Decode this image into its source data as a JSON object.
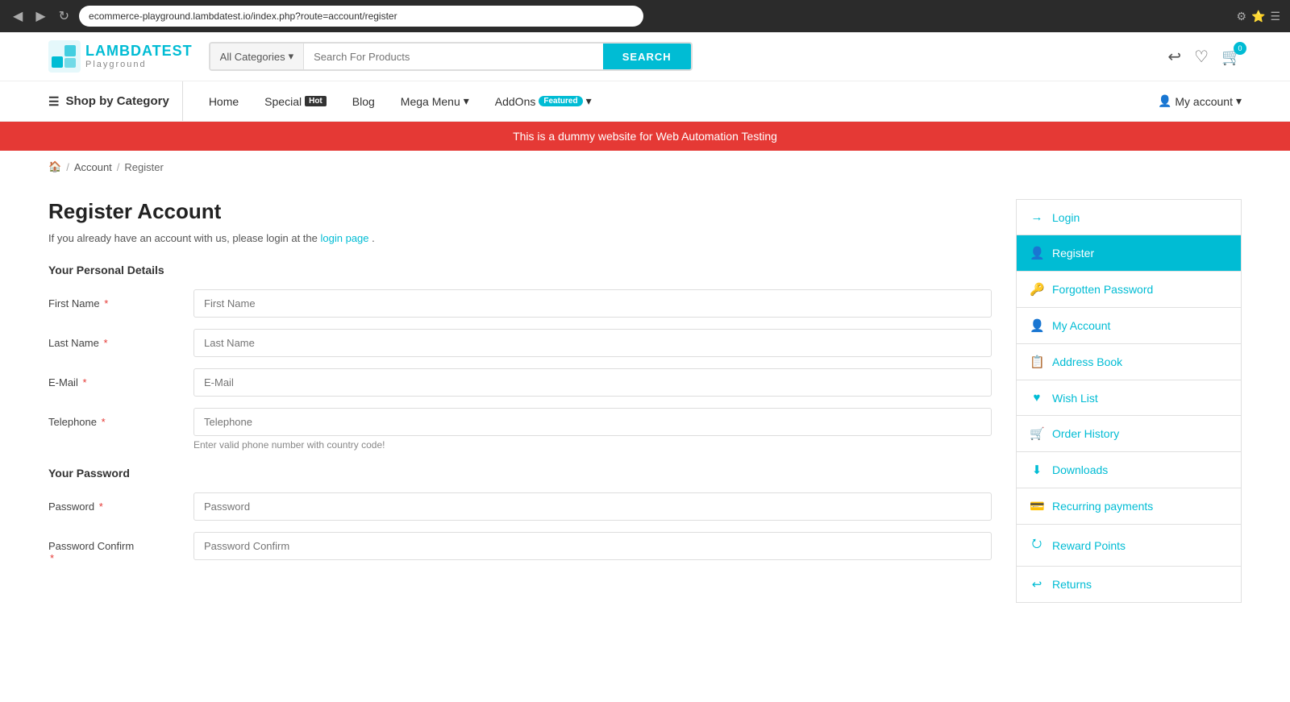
{
  "browser": {
    "url": "ecommerce-playground.lambdatest.io/index.php?route=account/register",
    "nav_back": "◀",
    "nav_forward": "▶",
    "reload": "↻"
  },
  "header": {
    "logo_main": "LAMBDATEST",
    "logo_sub": "Playground",
    "search_category": "All Categories",
    "search_placeholder": "Search For Products",
    "search_button": "SEARCH",
    "cart_count": "0"
  },
  "nav": {
    "shop_by_category": "Shop by Category",
    "home": "Home",
    "special": "Special",
    "special_badge": "Hot",
    "blog": "Blog",
    "mega_menu": "Mega Menu",
    "addons": "AddOns",
    "addons_badge": "Featured",
    "my_account": "My account"
  },
  "banner": {
    "text": "This is a dummy website for Web Automation Testing"
  },
  "breadcrumb": {
    "home_icon": "🏠",
    "account": "Account",
    "register": "Register"
  },
  "form": {
    "title": "Register Account",
    "intro": "If you already have an account with us, please login at the",
    "login_link_text": "login page",
    "intro_end": ".",
    "personal_details_title": "Your Personal Details",
    "first_name_label": "First Name",
    "first_name_placeholder": "First Name",
    "last_name_label": "Last Name",
    "last_name_placeholder": "Last Name",
    "email_label": "E-Mail",
    "email_placeholder": "E-Mail",
    "telephone_label": "Telephone",
    "telephone_placeholder": "Telephone",
    "telephone_hint": "Enter valid phone number with country code!",
    "password_title": "Your Password",
    "password_label": "Password",
    "password_placeholder": "Password",
    "password_confirm_label": "Password Confirm",
    "password_confirm_placeholder": "Password Confirm"
  },
  "sidebar": {
    "items": [
      {
        "id": "login",
        "label": "Login",
        "icon": "→",
        "active": false
      },
      {
        "id": "register",
        "label": "Register",
        "icon": "👤+",
        "active": true
      },
      {
        "id": "forgotten-password",
        "label": "Forgotten Password",
        "icon": "🔑",
        "active": false
      },
      {
        "id": "my-account",
        "label": "My Account",
        "icon": "👤",
        "active": false
      },
      {
        "id": "address-book",
        "label": "Address Book",
        "icon": "📋",
        "active": false
      },
      {
        "id": "wish-list",
        "label": "Wish List",
        "icon": "♥",
        "active": false
      },
      {
        "id": "order-history",
        "label": "Order History",
        "icon": "🛒",
        "active": false
      },
      {
        "id": "downloads",
        "label": "Downloads",
        "icon": "⬇",
        "active": false
      },
      {
        "id": "recurring-payments",
        "label": "Recurring payments",
        "icon": "💳",
        "active": false
      },
      {
        "id": "reward-points",
        "label": "Reward Points",
        "icon": "⭮",
        "active": false
      },
      {
        "id": "returns",
        "label": "Returns",
        "icon": "↩",
        "active": false
      }
    ]
  }
}
